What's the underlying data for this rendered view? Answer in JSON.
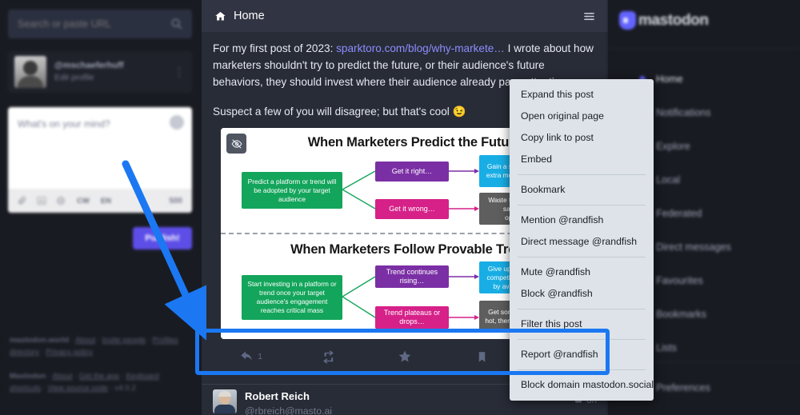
{
  "left_sidebar": {
    "search": {
      "placeholder": "Search or paste URL",
      "icon": "search-icon"
    },
    "profile": {
      "handle": "@mschaeferhuff",
      "edit_label": "Edit profile",
      "menu_icon": "vertical-dots-icon"
    },
    "compose": {
      "placeholder": "What's on your mind?",
      "char_count": "500",
      "cw_label": "CW",
      "lang_label": "EN",
      "toolbar_icons": [
        "paperclip-icon",
        "poll-icon",
        "globe-icon"
      ],
      "publish_label": "Publish!"
    },
    "footer": {
      "line1": [
        "mastodon.world",
        "About",
        "Invite people",
        "Profiles directory",
        "Privacy policy"
      ],
      "line2": [
        "Mastodon",
        "About",
        "Get the app",
        "Keyboard shortcuts",
        "View source code",
        "v4.0.2"
      ]
    }
  },
  "center_column": {
    "header": {
      "title": "Home",
      "home_icon": "home-icon",
      "settings_icon": "sliders-icon"
    },
    "status": {
      "text_before_link": "For my first post of 2023: ",
      "link_text": "sparktoro.com/blog/why-markete…",
      "text_after_link": " I wrote about how marketers shouldn't try to predict the future, or their audience's future behaviors, they should invest where their audience already pays attention.",
      "second_paragraph": "Suspect a few of you will disagree; but that's cool 😉",
      "media": {
        "hide_icon": "hide-media-icon",
        "diagrams": [
          {
            "title": "When Marketers Predict the Future",
            "source": "Predict a platform or trend will be adopted by your target audience",
            "branches": [
              {
                "label": "Get it right…",
                "outcome": "Gain a slight edge, a few extra months of exposure"
              },
              {
                "label": "Get it wrong…",
                "outcome": "Waste time, money, and sacrifice other opportunities"
              }
            ]
          },
          {
            "title": "When Marketers Follow Provable Trends",
            "source": "Start investing in a platform or trend once your target audience's engagement reaches critical mass",
            "branches": [
              {
                "label": "Trend continues rising…",
                "outcome": "Give up small edge over competitors, save money by avoiding bad bets"
              },
              {
                "label": "Trend plateaus or drops…",
                "outcome": "Get some ROI while it is hot, then invest elsewhere"
              }
            ]
          }
        ]
      },
      "actions": {
        "reply": {
          "icon": "reply-icon",
          "count": "1"
        },
        "boost": {
          "icon": "boost-icon",
          "count": ""
        },
        "favourite": {
          "icon": "star-icon",
          "count": ""
        },
        "bookmark": {
          "icon": "bookmark-icon",
          "count": ""
        },
        "more": {
          "icon": "ellipsis-icon",
          "count": ""
        }
      }
    },
    "next_post": {
      "display_name": "Robert Reich",
      "handle": "@rbreich@masto.ai",
      "timestamp": "8h",
      "visibility_icon": "unlocked-icon"
    }
  },
  "context_menu": {
    "groups": [
      [
        "Expand this post",
        "Open original page",
        "Copy link to post",
        "Embed"
      ],
      [
        "Bookmark"
      ],
      [
        "Mention @randfish",
        "Direct message @randfish"
      ],
      [
        "Mute @randfish",
        "Block @randfish"
      ],
      [
        "Filter this post"
      ],
      [
        "Report @randfish"
      ],
      [
        "Block domain mastodon.social"
      ]
    ]
  },
  "right_sidebar": {
    "brand": "mastodon",
    "items": [
      {
        "label": "Home",
        "icon": "home-icon",
        "active": true
      },
      {
        "label": "Notifications",
        "icon": "bell-icon",
        "active": false
      },
      {
        "label": "Explore",
        "icon": "hashtag-icon",
        "active": false
      },
      {
        "label": "Local",
        "icon": "users-icon",
        "active": false
      },
      {
        "label": "Federated",
        "icon": "globe-icon",
        "active": false
      },
      {
        "label": "Direct messages",
        "icon": "envelope-icon",
        "active": false
      },
      {
        "label": "Favourites",
        "icon": "star-icon",
        "active": false
      },
      {
        "label": "Bookmarks",
        "icon": "bookmark-icon",
        "active": false
      },
      {
        "label": "Lists",
        "icon": "list-icon",
        "active": false
      }
    ],
    "preferences": {
      "label": "Preferences",
      "icon": "gear-icon"
    }
  },
  "annotation": {
    "box_color": "#1b78f2",
    "arrow_color": "#1b78f2"
  },
  "colors": {
    "accent": "#6364ff",
    "column_bg": "#282c37",
    "page_bg": "#191b22",
    "menu_bg": "#dde3e9",
    "highlight": "#1b78f2"
  }
}
